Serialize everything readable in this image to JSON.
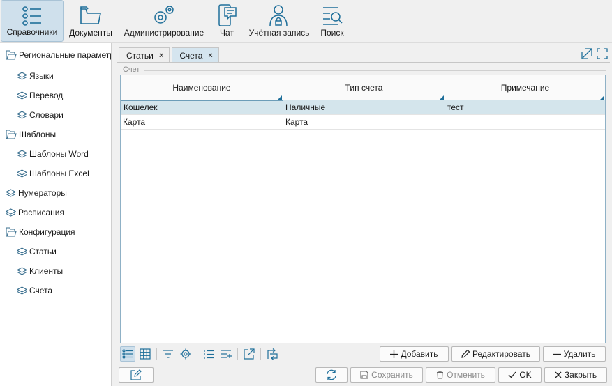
{
  "toolbar": {
    "items": [
      {
        "label": "Справочники",
        "icon": "list-icon"
      },
      {
        "label": "Документы",
        "icon": "folder-icon"
      },
      {
        "label": "Администрирование",
        "icon": "gear-icon"
      },
      {
        "label": "Чат",
        "icon": "chat-icon"
      },
      {
        "label": "Учётная запись",
        "icon": "user-lock-icon"
      },
      {
        "label": "Поиск",
        "icon": "search-list-icon"
      }
    ]
  },
  "tree": {
    "items": [
      {
        "label": "Региональные параметры",
        "icon": "folder-open-icon"
      },
      {
        "label": "Языки",
        "icon": "layers-icon"
      },
      {
        "label": "Перевод",
        "icon": "layers-icon"
      },
      {
        "label": "Словари",
        "icon": "layers-icon"
      },
      {
        "label": "Шаблоны",
        "icon": "folder-open-icon"
      },
      {
        "label": "Шаблоны Word",
        "icon": "layers-icon"
      },
      {
        "label": "Шаблоны Excel",
        "icon": "layers-icon"
      },
      {
        "label": "Нумераторы",
        "icon": "layers-icon"
      },
      {
        "label": "Расписания",
        "icon": "layers-icon"
      },
      {
        "label": "Конфигурация",
        "icon": "folder-open-icon"
      },
      {
        "label": "Статьи",
        "icon": "layers-icon"
      },
      {
        "label": "Клиенты",
        "icon": "layers-icon"
      },
      {
        "label": "Счета",
        "icon": "layers-icon"
      }
    ]
  },
  "tabs": [
    {
      "label": "Статьи",
      "close": "×"
    },
    {
      "label": "Счета",
      "close": "×"
    }
  ],
  "group": {
    "label": "Счет"
  },
  "grid": {
    "columns": [
      "Наименование",
      "Тип счета",
      "Примечание"
    ],
    "rows": [
      [
        "Кошелек",
        "Наличные",
        "тест"
      ],
      [
        "Карта",
        "Карта",
        ""
      ]
    ]
  },
  "grid_buttons": {
    "add": "Добавить",
    "edit": "Редактировать",
    "delete": "Удалить"
  },
  "footer_buttons": {
    "save": "Сохранить",
    "cancel": "Отменить",
    "ok": "OK",
    "close": "Закрыть"
  },
  "colors": {
    "accent": "#1f6f9a",
    "selection": "#d4e5ec",
    "active_tab": "#d5e5ef"
  }
}
